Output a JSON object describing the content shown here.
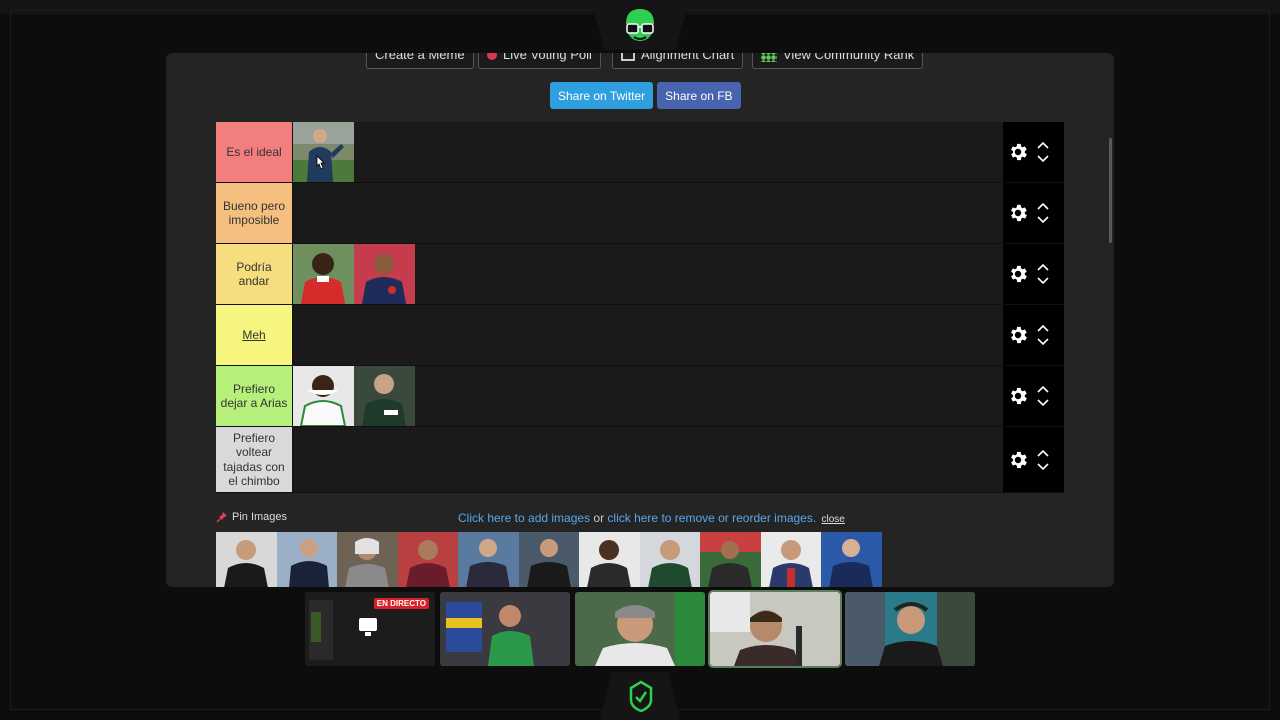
{
  "top_buttons": {
    "create_meme": "Create a Meme",
    "live_voting": "Live Voting Poll",
    "alignment": "Alignment Chart",
    "community": "View Community Rank"
  },
  "share": {
    "twitter": "Share on Twitter",
    "facebook": "Share on FB"
  },
  "tiers": [
    {
      "label": "Es el ideal",
      "color": "#f27e7e",
      "items": 1
    },
    {
      "label": "Bueno pero imposible",
      "color": "#f5bf7f",
      "items": 0
    },
    {
      "label": "Podría andar",
      "color": "#f6de7f",
      "items": 2
    },
    {
      "label": "Meh",
      "color": "#f6f67e",
      "items": 0
    },
    {
      "label": "Prefiero dejar a Arias",
      "color": "#b6f07b",
      "items": 2
    },
    {
      "label": "Prefiero voltear tajadas con el chimbo",
      "color": "#d9d9d9",
      "items": 0
    }
  ],
  "pin": {
    "label": "Pin Images",
    "add_link": "Click here to add images",
    "or": " or ",
    "reorder_link": "click here to remove or reorder images.",
    "close": "close"
  },
  "pool_count": 11,
  "live_badge": "EN DIRECTO",
  "icons": {
    "gear": "gear-icon",
    "up": "chevron-up-icon",
    "down": "chevron-down-icon",
    "pin": "pin-icon"
  }
}
